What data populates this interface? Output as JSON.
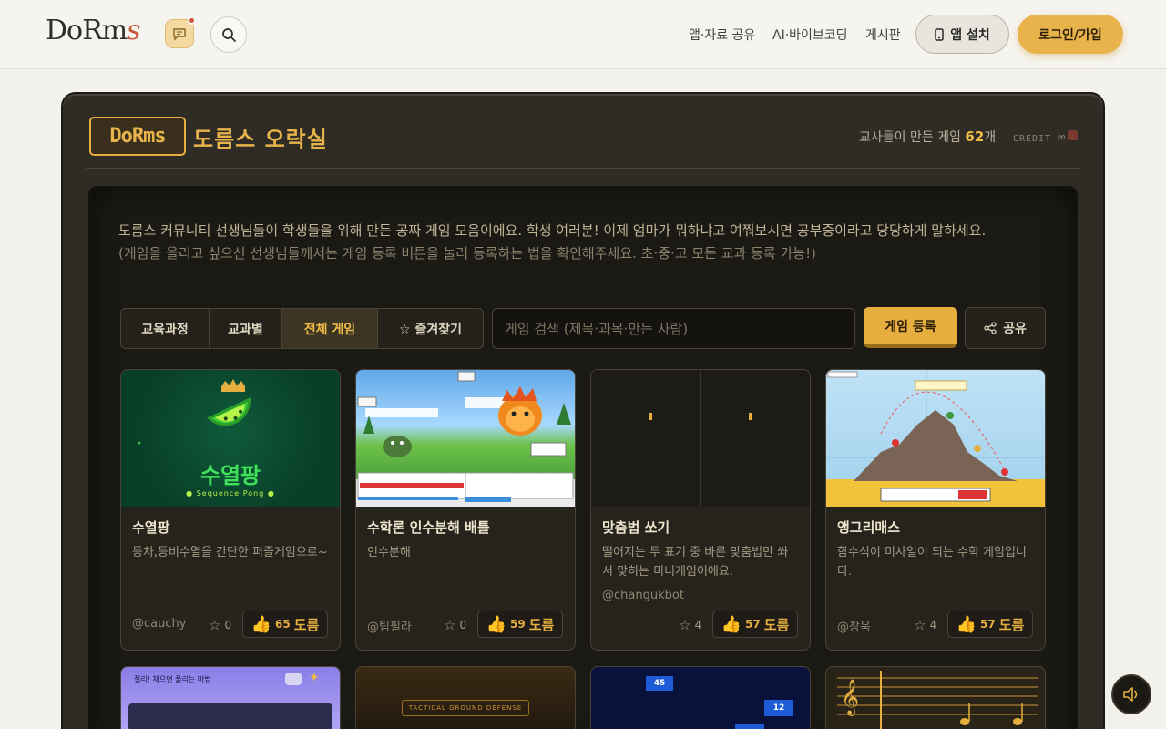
{
  "header": {
    "logo_text": "DoRm",
    "logo_accent": "s",
    "nav": [
      "앱·자료 공유",
      "AI·바이브코딩",
      "게시판"
    ],
    "install_label": "앱 설치",
    "login_label": "로그인/가입"
  },
  "arcade": {
    "brand_box": "DoRms",
    "title": "도름스 오락실",
    "counter_prefix": "교사들이 만든 게임",
    "counter_value": "62",
    "counter_suffix": "개",
    "credit_label": "CREDIT",
    "credit_value": "∞",
    "intro_main": "도름스 커뮤니티 선생님들이 학생들을 위해 만든 공짜 게임 모음이에요. 학생 여러분! 이제 엄마가 뭐하냐고 여쭤보시면 공부중이라고 당당하게 말하세요.",
    "intro_muted": "(게임을 올리고 싶으신 선생님들께서는 게임 등록 버튼을 눌러 등록하는 법을 확인해주세요. 초·중·고 모든 교과 등록 가능!)",
    "tabs": [
      "교육과정",
      "교과별",
      "전체 게임",
      "☆ 즐겨찾기"
    ],
    "active_tab": "전체 게임",
    "search_placeholder": "게임 검색 (제목·과목·만든 사람)",
    "register_label": "게임 등록",
    "share_label": "공유"
  },
  "thumbs": {
    "card1_title": "수열팡",
    "card1_subtitle": "Sequence Pong",
    "card7_banner": "TACTICAL GROUND DEFENSE",
    "card5_banner": "절리! 채으면 풀리는 마법",
    "card8_num1": "45",
    "card8_num2": "12"
  },
  "cards": [
    {
      "title": "수열팡",
      "desc": "등차,등비수열을 간단한 퍼즐게임으로~",
      "author": "@cauchy",
      "favs": "0",
      "likes": "65",
      "unit": "도름"
    },
    {
      "title": "수학론 인수분해 배틀",
      "desc": "인수분해",
      "author": "@팀필라",
      "favs": "0",
      "likes": "59",
      "unit": "도름"
    },
    {
      "title": "맞춤법 쏘기",
      "desc": "떨어지는 두 표기 중 바른 맞춤법만 쏴서 맞히는 미니게임이에요.",
      "author": "@changukbot",
      "favs": "4",
      "likes": "57",
      "unit": "도름"
    },
    {
      "title": "앵그리매스",
      "desc": "함수식이 미사일이 되는 수학 게임입니다.",
      "author": "@창욱",
      "favs": "4",
      "likes": "57",
      "unit": "도름"
    }
  ],
  "colors": {
    "accent": "#e5ae3e",
    "frame": "#2f2b25",
    "screen": "#1b1914",
    "page_bg": "#f3f1ec"
  }
}
